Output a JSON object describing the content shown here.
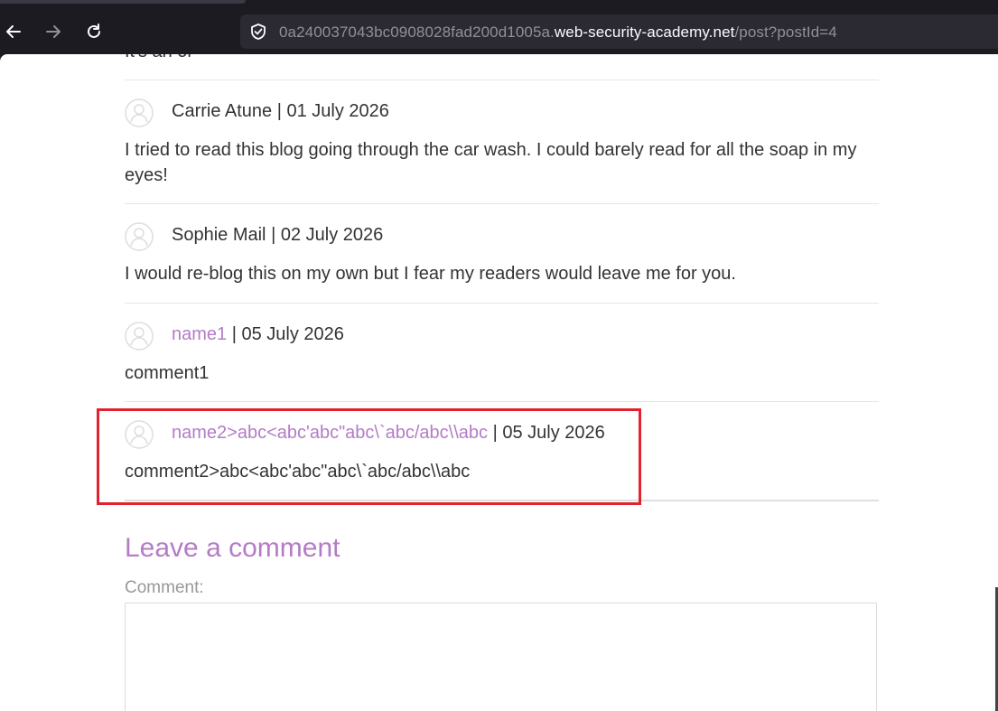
{
  "browser": {
    "url_prefix": "0a240037043bc0908028fad200d1005a.",
    "url_host": "web-security-academy.net",
    "url_path": "/post?postId=4"
  },
  "page": {
    "cut_off_text": "It's an or",
    "comments": [
      {
        "author": "Carrie Atune",
        "date": " | 01 July 2026",
        "text": "I tried to read this blog going through the car wash. I could barely read for all the soap in my eyes!"
      },
      {
        "author": "Sophie Mail",
        "date": " | 02 July 2026",
        "text": "I would re-blog this on my own but I fear my readers would leave me for you."
      },
      {
        "author": "name1",
        "date": " | 05 July 2026",
        "text": "comment1"
      },
      {
        "author": "name2>abc<abc'abc\"abc\\`abc/abc\\\\abc",
        "date": " | 05 July 2026",
        "text": "comment2>abc<abc'abc\"abc\\`abc/abc\\\\abc"
      }
    ],
    "leave_comment_title": "Leave a comment",
    "comment_label": "Comment:"
  },
  "colors": {
    "link": "#b37cc6",
    "highlight": "#e0232e"
  }
}
